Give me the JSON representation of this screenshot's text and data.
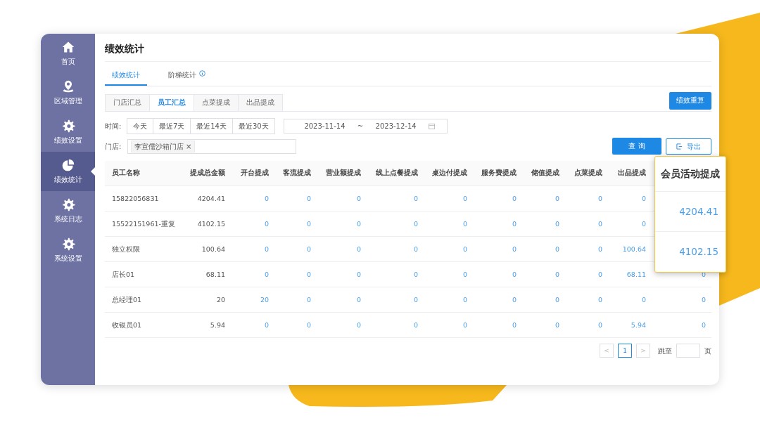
{
  "sidebar": {
    "items": [
      {
        "label": "首页",
        "selected": false
      },
      {
        "label": "区域管理",
        "selected": false
      },
      {
        "label": "绩效设置",
        "selected": false
      },
      {
        "label": "绩效统计",
        "selected": true
      },
      {
        "label": "系统日志",
        "selected": false
      },
      {
        "label": "系统设置",
        "selected": false
      }
    ]
  },
  "page_title": "绩效统计",
  "tabs": [
    {
      "label": "绩效统计",
      "selected": true,
      "info": false
    },
    {
      "label": "阶梯统计",
      "selected": false,
      "info": true
    }
  ],
  "sub_tabs": [
    {
      "label": "门店汇总",
      "selected": false
    },
    {
      "label": "员工汇总",
      "selected": true
    },
    {
      "label": "点菜提成",
      "selected": false
    },
    {
      "label": "出品提成",
      "selected": false
    }
  ],
  "recalc_button": "绩效重算",
  "filters": {
    "time_label": "时间:",
    "quick_ranges": [
      "今天",
      "最近7天",
      "最近14天",
      "最近30天"
    ],
    "date_start": "2023-11-14",
    "date_separator": "~",
    "date_end": "2023-12-14",
    "store_label": "门店:",
    "store_tags": [
      {
        "label": "李宣儒沙箱门店",
        "remove": "×"
      }
    ]
  },
  "query_button": "查 询",
  "export_button": "导出",
  "table": {
    "columns": [
      "员工名称",
      "提成总金额",
      "开台提成",
      "客流提成",
      "营业额提成",
      "线上点餐提成",
      "桌边付提成",
      "服务费提成",
      "储值提成",
      "点菜提成",
      "出品提成"
    ],
    "rows": [
      {
        "cells": [
          "15822056831",
          "4204.41",
          "0",
          "0",
          "0",
          "0",
          "0",
          "0",
          "0",
          "0",
          "0"
        ]
      },
      {
        "cells": [
          "15522151961-重复",
          "4102.15",
          "0",
          "0",
          "0",
          "0",
          "0",
          "0",
          "0",
          "0",
          "0"
        ]
      },
      {
        "cells": [
          "独立权限",
          "100.64",
          "0",
          "0",
          "0",
          "0",
          "0",
          "0",
          "0",
          "0",
          "100.64"
        ]
      },
      {
        "cells": [
          "店长01",
          "68.11",
          "0",
          "0",
          "0",
          "0",
          "0",
          "0",
          "0",
          "0",
          "68.11",
          "0"
        ]
      },
      {
        "cells": [
          "总经理01",
          "20",
          "20",
          "0",
          "0",
          "0",
          "0",
          "0",
          "0",
          "0",
          "0",
          "0"
        ]
      },
      {
        "cells": [
          "收银员01",
          "5.94",
          "0",
          "0",
          "0",
          "0",
          "0",
          "0",
          "0",
          "0",
          "5.94",
          "0"
        ]
      }
    ]
  },
  "pagination": {
    "prev": "<",
    "pages": [
      {
        "label": "1",
        "selected": true
      }
    ],
    "next": ">",
    "jump_label": "跳至",
    "page_suffix": "页"
  },
  "popup": {
    "title": "会员活动提成",
    "values": [
      "4204.41",
      "4102.15"
    ]
  }
}
